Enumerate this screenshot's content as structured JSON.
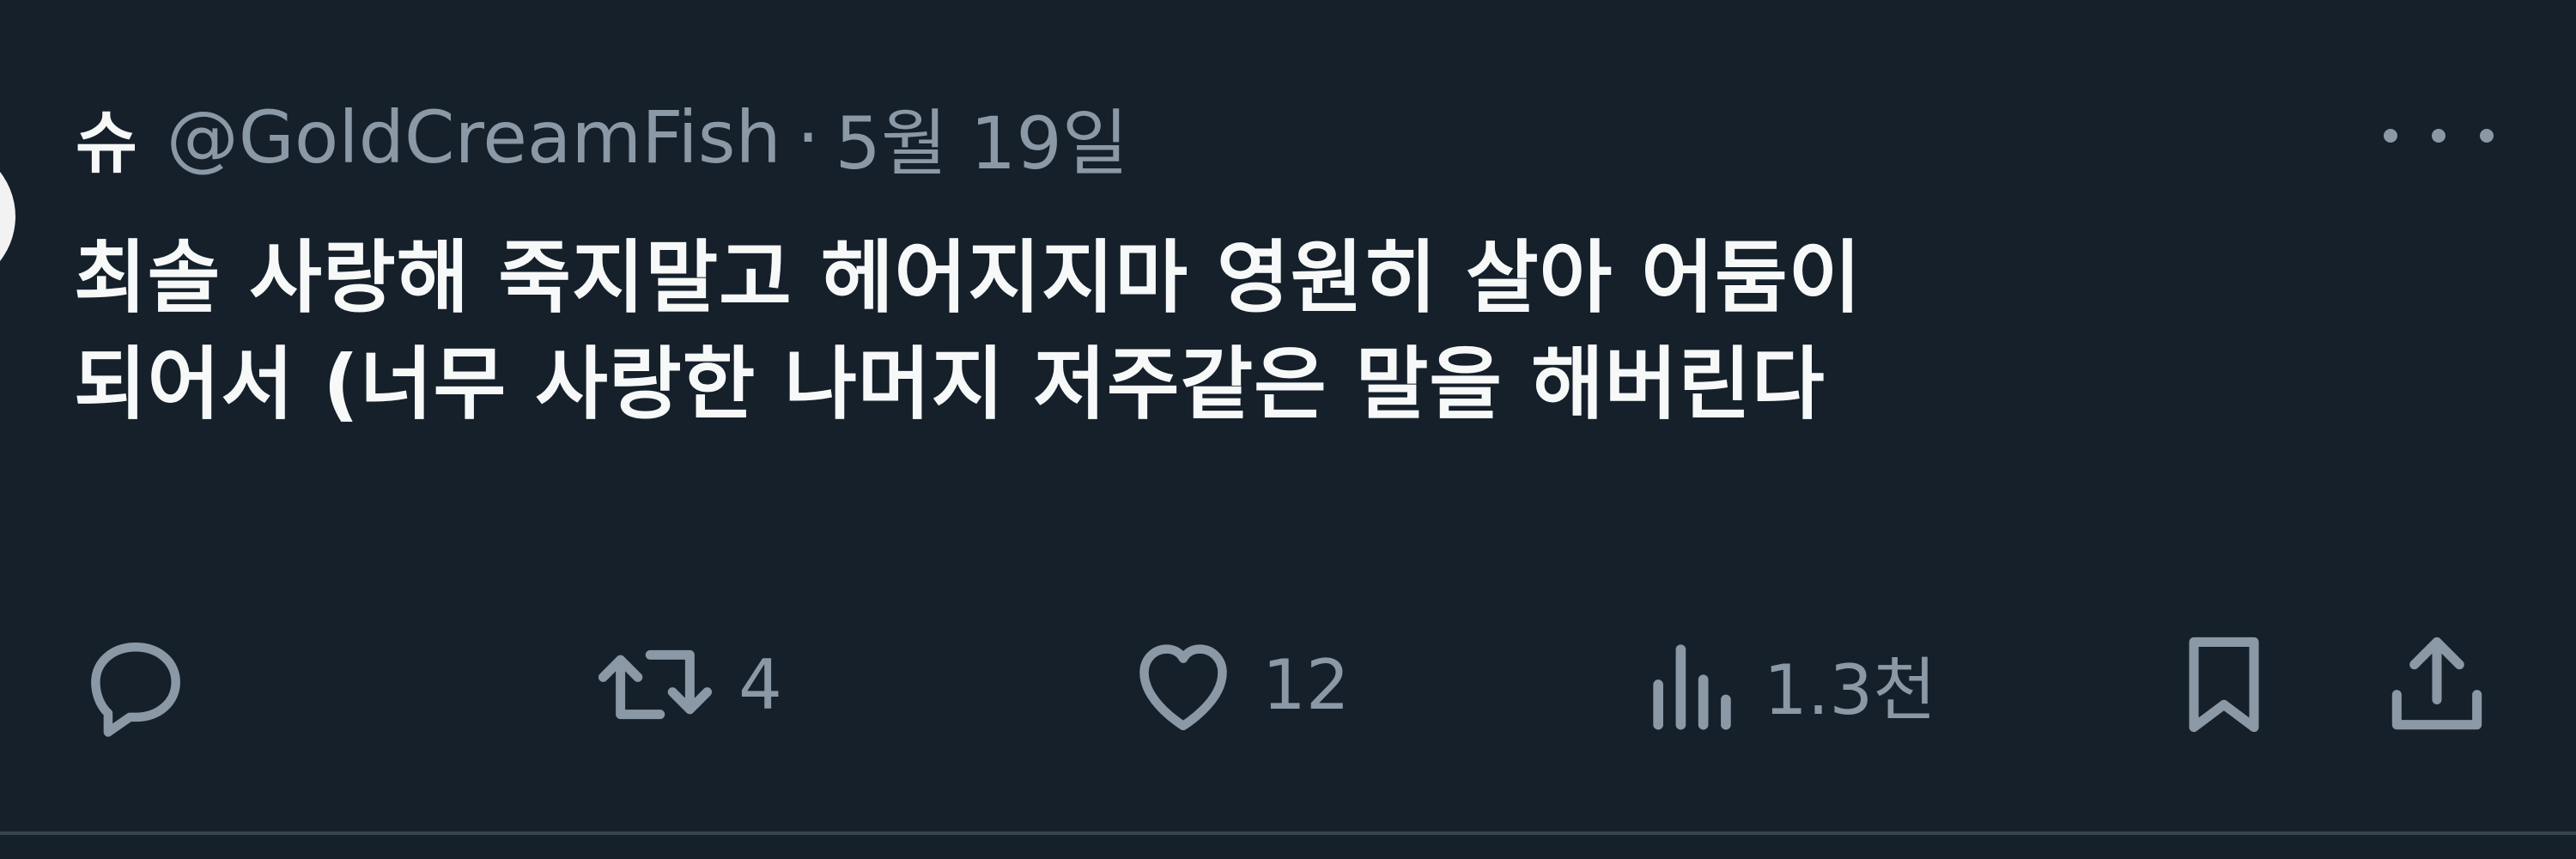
{
  "top_fragment": "",
  "tweet": {
    "display_name": "슈",
    "handle": "@GoldCreamFish",
    "separator": "·",
    "time": "5월 19일",
    "more_icon": "more-horizontal-icon",
    "text_lines": [
      "최솔 사랑해 죽지말고 헤어지지마 영원히 살아 어둠이",
      "되어서 (너무 사랑한 나머지 저주같은 말을 해버린다"
    ]
  },
  "actions": {
    "reply": {
      "icon": "reply-icon",
      "count": ""
    },
    "retweet": {
      "icon": "retweet-icon",
      "count": "4"
    },
    "like": {
      "icon": "heart-icon",
      "count": "12"
    },
    "views": {
      "icon": "views-chart-icon",
      "count": "1.3천"
    },
    "bookmark": {
      "icon": "bookmark-icon"
    },
    "share": {
      "icon": "share-icon"
    }
  },
  "colors": {
    "background": "#15202b",
    "primary_text": "#f7f9f9",
    "secondary_text": "#8b98a5",
    "divider": "#38444d"
  }
}
